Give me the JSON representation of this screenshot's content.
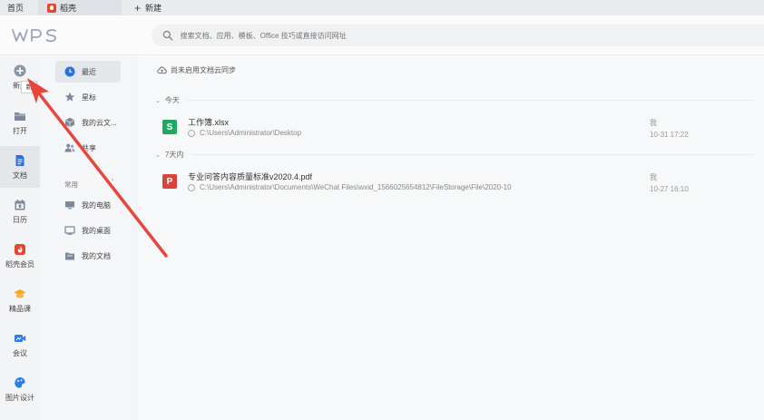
{
  "tabs": [
    {
      "label": "首页"
    },
    {
      "label": "稻壳"
    },
    {
      "label": "新建"
    }
  ],
  "header": {
    "search_placeholder": "搜索文档、应用、模板、Office 技巧或直接访问网址"
  },
  "rail": {
    "items": [
      {
        "label": "新建",
        "icon": "plus-circle-icon"
      },
      {
        "label": "打开",
        "icon": "folder-icon"
      },
      {
        "label": "文档",
        "icon": "document-icon"
      },
      {
        "label": "日历",
        "icon": "calendar-icon"
      },
      {
        "label": "稻壳会员",
        "icon": "docer-icon"
      },
      {
        "label": "精品课",
        "icon": "graduation-cap-icon"
      },
      {
        "label": "会议",
        "icon": "video-meeting-icon"
      },
      {
        "label": "图片设计",
        "icon": "image-design-icon"
      }
    ],
    "tooltip": "新"
  },
  "nav": {
    "items": [
      {
        "label": "最近",
        "icon": "clock-icon"
      },
      {
        "label": "星标",
        "icon": "star-icon"
      },
      {
        "label": "我的云文...",
        "icon": "cloud-box-icon"
      },
      {
        "label": "共享",
        "icon": "people-icon"
      }
    ],
    "section_label": "常用",
    "common": [
      {
        "label": "我的电脑",
        "icon": "computer-icon"
      },
      {
        "label": "我的桌面",
        "icon": "desktop-icon"
      },
      {
        "label": "我的文档",
        "icon": "folder-doc-icon"
      }
    ]
  },
  "main": {
    "sync_text": "尚未启用文档云同步",
    "groups": [
      {
        "title": "今天",
        "files": [
          {
            "name": "工作簿.xlsx",
            "path": "C:\\Users\\Administrator\\Desktop",
            "owner": "我",
            "time": "10-31 17:22",
            "icon_letter": "S",
            "color": "#1fa863"
          }
        ]
      },
      {
        "title": "7天内",
        "files": [
          {
            "name": "专业问答内容质量标准v2020.4.pdf",
            "path": "C:\\Users\\Administrator\\Documents\\WeChat Files\\wxid_1566025654812\\FileStorage\\File\\2020-10",
            "owner": "我",
            "time": "10-27 16:10",
            "icon_letter": "P",
            "color": "#d9433a"
          }
        ]
      }
    ]
  },
  "colors": {
    "accent": "#2b6fe0",
    "arrow": "#e8453c"
  }
}
